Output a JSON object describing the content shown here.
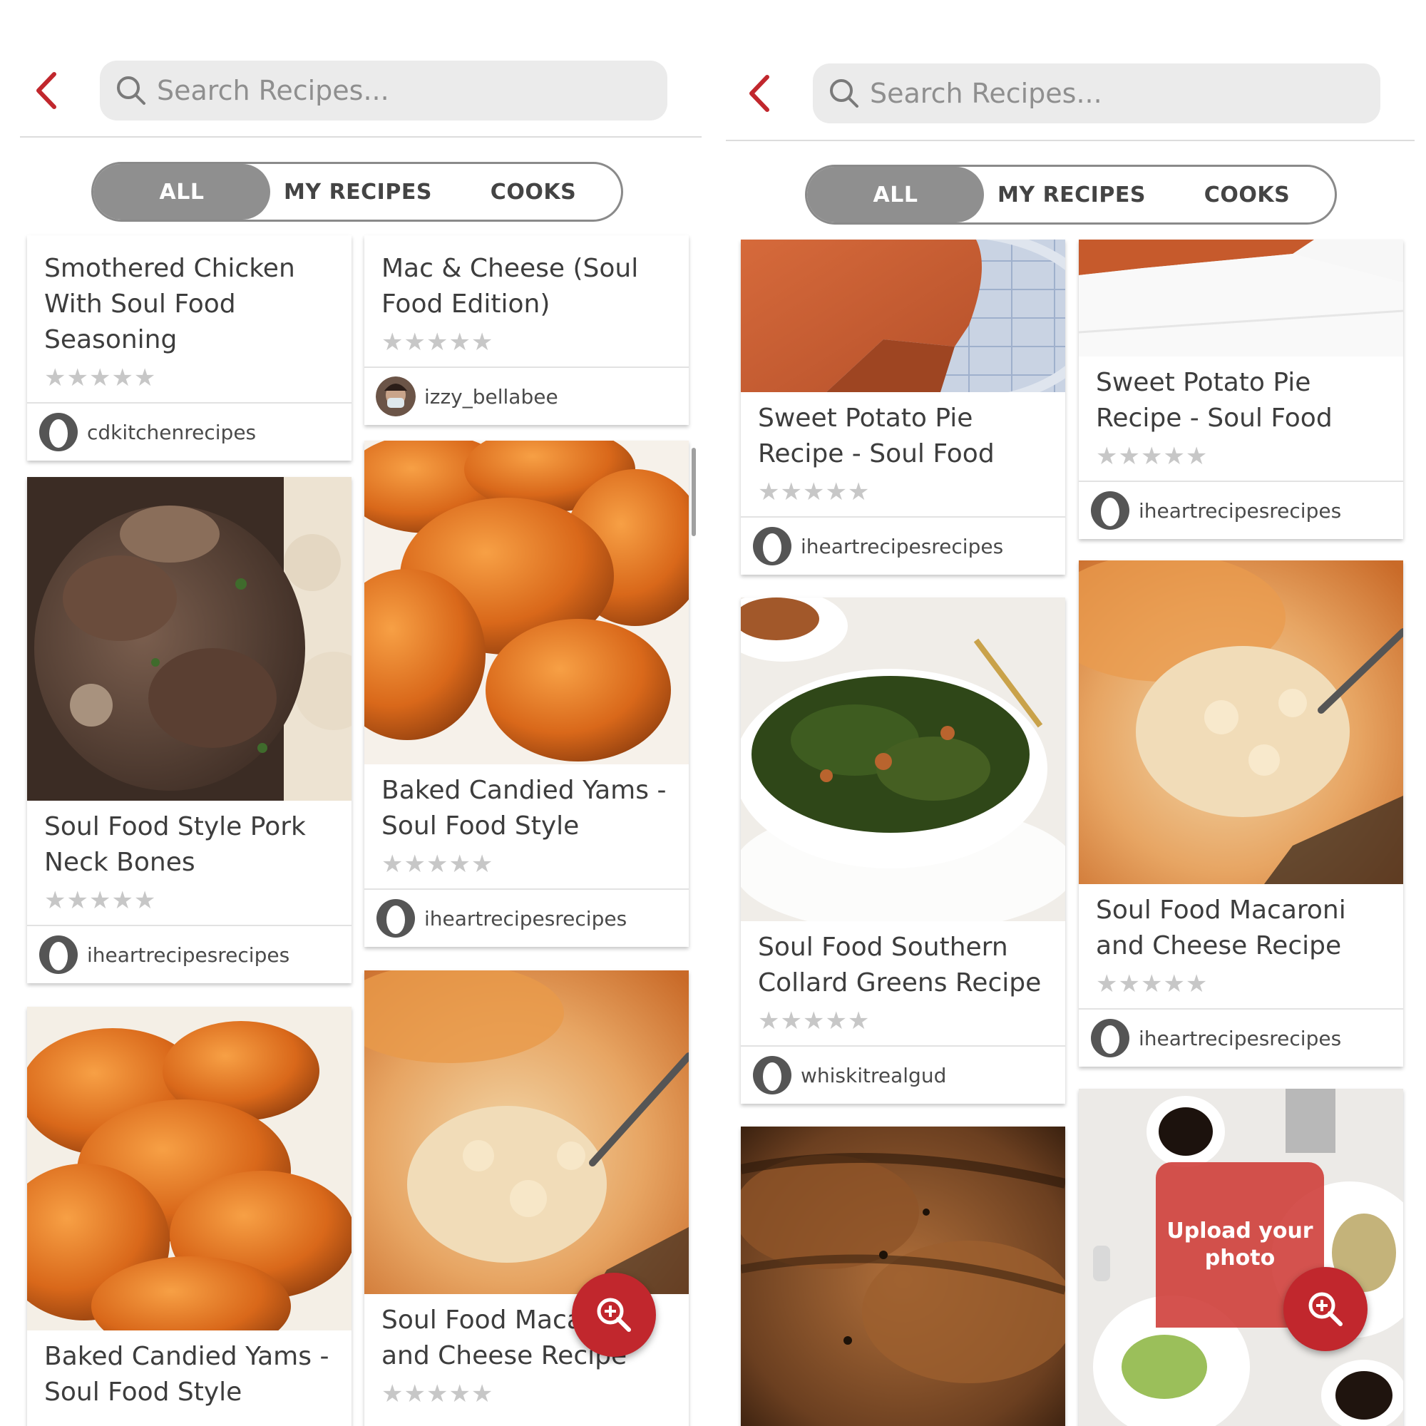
{
  "search": {
    "placeholder": "Search Recipes..."
  },
  "tabs": {
    "all": "ALL",
    "my_recipes": "MY RECIPES",
    "cooks": "COOKS",
    "selected": "ALL"
  },
  "colors": {
    "accent": "#c1272d",
    "segment_active": "#8f8f8f",
    "star": "#c7c7c7"
  },
  "icons": {
    "back": "chevron-left-icon",
    "search": "search-icon",
    "fab": "zoom-in-icon"
  },
  "left_screen": {
    "col1": [
      {
        "title": "Smothered Chicken With Soul Food Seasoning",
        "rating": "★★★★★",
        "author": "cdkitchenrecipes"
      },
      {
        "title": "Soul Food Style Pork Neck Bones",
        "rating": "★★★★★",
        "author": "iheartrecipesrecipes"
      },
      {
        "title": "Baked Candied Yams - Soul Food Style"
      }
    ],
    "col2": [
      {
        "title": "Mac & Cheese (Soul Food Edition)",
        "rating": "★★★★★",
        "author": "izzy_bellabee"
      },
      {
        "title": "Baked Candied Yams - Soul Food Style",
        "rating": "★★★★★",
        "author": "iheartrecipesrecipes"
      },
      {
        "title": "Soul Food Macaroni and Cheese Recipe",
        "rating": "★★★★★"
      }
    ]
  },
  "right_screen": {
    "col1": [
      {
        "title": "Sweet Potato Pie Recipe - Soul Food",
        "rating": "★★★★★",
        "author": "iheartrecipesrecipes"
      },
      {
        "title": "Soul Food Southern Collard Greens Recipe",
        "rating": "★★★★★",
        "author": "whiskitrealgud"
      }
    ],
    "col2": [
      {
        "title": "Sweet Potato Pie Recipe - Soul Food",
        "rating": "★★★★★",
        "author": "iheartrecipesrecipes"
      },
      {
        "title": "Soul Food Macaroni and Cheese Recipe",
        "rating": "★★★★★",
        "author": "iheartrecipesrecipes"
      }
    ],
    "upload_prompt": "Upload your photo"
  }
}
